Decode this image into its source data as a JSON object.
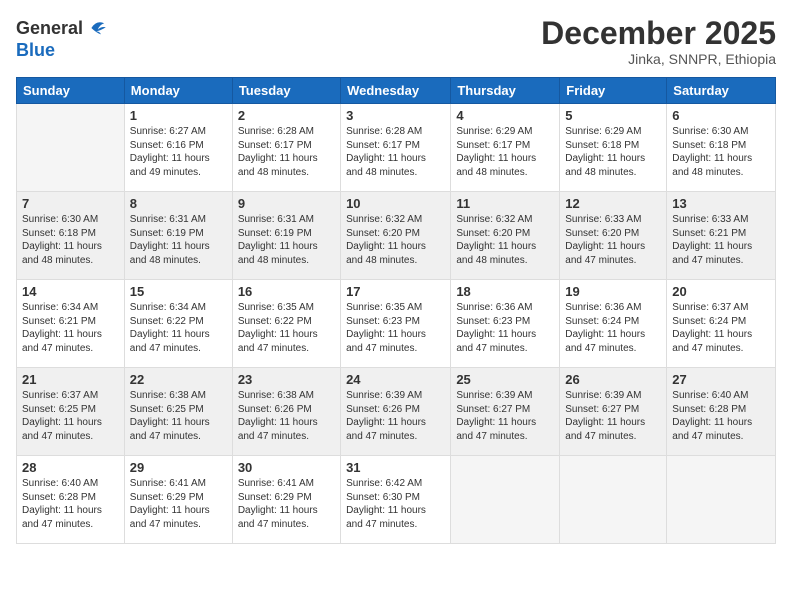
{
  "header": {
    "logo_general": "General",
    "logo_blue": "Blue",
    "month": "December 2025",
    "location": "Jinka, SNNPR, Ethiopia"
  },
  "weekdays": [
    "Sunday",
    "Monday",
    "Tuesday",
    "Wednesday",
    "Thursday",
    "Friday",
    "Saturday"
  ],
  "weeks": [
    [
      {
        "day": "",
        "sunrise": "",
        "sunset": "",
        "daylight": ""
      },
      {
        "day": "1",
        "sunrise": "Sunrise: 6:27 AM",
        "sunset": "Sunset: 6:16 PM",
        "daylight": "Daylight: 11 hours and 49 minutes."
      },
      {
        "day": "2",
        "sunrise": "Sunrise: 6:28 AM",
        "sunset": "Sunset: 6:17 PM",
        "daylight": "Daylight: 11 hours and 48 minutes."
      },
      {
        "day": "3",
        "sunrise": "Sunrise: 6:28 AM",
        "sunset": "Sunset: 6:17 PM",
        "daylight": "Daylight: 11 hours and 48 minutes."
      },
      {
        "day": "4",
        "sunrise": "Sunrise: 6:29 AM",
        "sunset": "Sunset: 6:17 PM",
        "daylight": "Daylight: 11 hours and 48 minutes."
      },
      {
        "day": "5",
        "sunrise": "Sunrise: 6:29 AM",
        "sunset": "Sunset: 6:18 PM",
        "daylight": "Daylight: 11 hours and 48 minutes."
      },
      {
        "day": "6",
        "sunrise": "Sunrise: 6:30 AM",
        "sunset": "Sunset: 6:18 PM",
        "daylight": "Daylight: 11 hours and 48 minutes."
      }
    ],
    [
      {
        "day": "7",
        "sunrise": "Sunrise: 6:30 AM",
        "sunset": "Sunset: 6:18 PM",
        "daylight": "Daylight: 11 hours and 48 minutes."
      },
      {
        "day": "8",
        "sunrise": "Sunrise: 6:31 AM",
        "sunset": "Sunset: 6:19 PM",
        "daylight": "Daylight: 11 hours and 48 minutes."
      },
      {
        "day": "9",
        "sunrise": "Sunrise: 6:31 AM",
        "sunset": "Sunset: 6:19 PM",
        "daylight": "Daylight: 11 hours and 48 minutes."
      },
      {
        "day": "10",
        "sunrise": "Sunrise: 6:32 AM",
        "sunset": "Sunset: 6:20 PM",
        "daylight": "Daylight: 11 hours and 48 minutes."
      },
      {
        "day": "11",
        "sunrise": "Sunrise: 6:32 AM",
        "sunset": "Sunset: 6:20 PM",
        "daylight": "Daylight: 11 hours and 48 minutes."
      },
      {
        "day": "12",
        "sunrise": "Sunrise: 6:33 AM",
        "sunset": "Sunset: 6:20 PM",
        "daylight": "Daylight: 11 hours and 47 minutes."
      },
      {
        "day": "13",
        "sunrise": "Sunrise: 6:33 AM",
        "sunset": "Sunset: 6:21 PM",
        "daylight": "Daylight: 11 hours and 47 minutes."
      }
    ],
    [
      {
        "day": "14",
        "sunrise": "Sunrise: 6:34 AM",
        "sunset": "Sunset: 6:21 PM",
        "daylight": "Daylight: 11 hours and 47 minutes."
      },
      {
        "day": "15",
        "sunrise": "Sunrise: 6:34 AM",
        "sunset": "Sunset: 6:22 PM",
        "daylight": "Daylight: 11 hours and 47 minutes."
      },
      {
        "day": "16",
        "sunrise": "Sunrise: 6:35 AM",
        "sunset": "Sunset: 6:22 PM",
        "daylight": "Daylight: 11 hours and 47 minutes."
      },
      {
        "day": "17",
        "sunrise": "Sunrise: 6:35 AM",
        "sunset": "Sunset: 6:23 PM",
        "daylight": "Daylight: 11 hours and 47 minutes."
      },
      {
        "day": "18",
        "sunrise": "Sunrise: 6:36 AM",
        "sunset": "Sunset: 6:23 PM",
        "daylight": "Daylight: 11 hours and 47 minutes."
      },
      {
        "day": "19",
        "sunrise": "Sunrise: 6:36 AM",
        "sunset": "Sunset: 6:24 PM",
        "daylight": "Daylight: 11 hours and 47 minutes."
      },
      {
        "day": "20",
        "sunrise": "Sunrise: 6:37 AM",
        "sunset": "Sunset: 6:24 PM",
        "daylight": "Daylight: 11 hours and 47 minutes."
      }
    ],
    [
      {
        "day": "21",
        "sunrise": "Sunrise: 6:37 AM",
        "sunset": "Sunset: 6:25 PM",
        "daylight": "Daylight: 11 hours and 47 minutes."
      },
      {
        "day": "22",
        "sunrise": "Sunrise: 6:38 AM",
        "sunset": "Sunset: 6:25 PM",
        "daylight": "Daylight: 11 hours and 47 minutes."
      },
      {
        "day": "23",
        "sunrise": "Sunrise: 6:38 AM",
        "sunset": "Sunset: 6:26 PM",
        "daylight": "Daylight: 11 hours and 47 minutes."
      },
      {
        "day": "24",
        "sunrise": "Sunrise: 6:39 AM",
        "sunset": "Sunset: 6:26 PM",
        "daylight": "Daylight: 11 hours and 47 minutes."
      },
      {
        "day": "25",
        "sunrise": "Sunrise: 6:39 AM",
        "sunset": "Sunset: 6:27 PM",
        "daylight": "Daylight: 11 hours and 47 minutes."
      },
      {
        "day": "26",
        "sunrise": "Sunrise: 6:39 AM",
        "sunset": "Sunset: 6:27 PM",
        "daylight": "Daylight: 11 hours and 47 minutes."
      },
      {
        "day": "27",
        "sunrise": "Sunrise: 6:40 AM",
        "sunset": "Sunset: 6:28 PM",
        "daylight": "Daylight: 11 hours and 47 minutes."
      }
    ],
    [
      {
        "day": "28",
        "sunrise": "Sunrise: 6:40 AM",
        "sunset": "Sunset: 6:28 PM",
        "daylight": "Daylight: 11 hours and 47 minutes."
      },
      {
        "day": "29",
        "sunrise": "Sunrise: 6:41 AM",
        "sunset": "Sunset: 6:29 PM",
        "daylight": "Daylight: 11 hours and 47 minutes."
      },
      {
        "day": "30",
        "sunrise": "Sunrise: 6:41 AM",
        "sunset": "Sunset: 6:29 PM",
        "daylight": "Daylight: 11 hours and 47 minutes."
      },
      {
        "day": "31",
        "sunrise": "Sunrise: 6:42 AM",
        "sunset": "Sunset: 6:30 PM",
        "daylight": "Daylight: 11 hours and 47 minutes."
      },
      {
        "day": "",
        "sunrise": "",
        "sunset": "",
        "daylight": ""
      },
      {
        "day": "",
        "sunrise": "",
        "sunset": "",
        "daylight": ""
      },
      {
        "day": "",
        "sunrise": "",
        "sunset": "",
        "daylight": ""
      }
    ]
  ]
}
